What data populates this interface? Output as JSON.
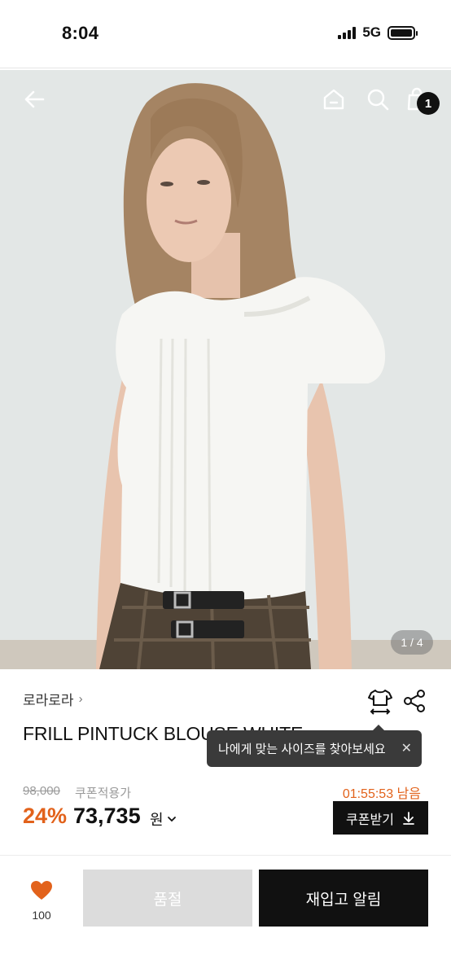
{
  "status_bar": {
    "time": "8:04",
    "network": "5G"
  },
  "header": {
    "back_icon": "arrow-left-icon",
    "home_icon": "home-icon",
    "search_icon": "search-icon",
    "cart_icon": "shopping-bag-icon",
    "cart_count": "1"
  },
  "gallery": {
    "counter": "1 / 4"
  },
  "product": {
    "brand": "로라로라",
    "brand_chevron": "›",
    "name": "FRILL PINTUCK BLOUSE WHITE",
    "size_icon": "shirt-size-icon",
    "share_icon": "share-icon"
  },
  "tooltip": {
    "text": "나에게 맞는 사이즈를 찾아보세요",
    "close": "✕"
  },
  "pricing": {
    "original_price": "98,000",
    "coupon_label": "쿠폰적용가",
    "countdown": "01:55:53",
    "countdown_suffix": "남음",
    "discount": "24%",
    "price": "73,735",
    "unit": "원",
    "coupon_button": "쿠폰받기",
    "accent_color": "#e2621b"
  },
  "actions": {
    "like_icon": "heart-icon",
    "like_count": "100",
    "sold_out_label": "품절",
    "restock_label": "재입고 알림"
  }
}
